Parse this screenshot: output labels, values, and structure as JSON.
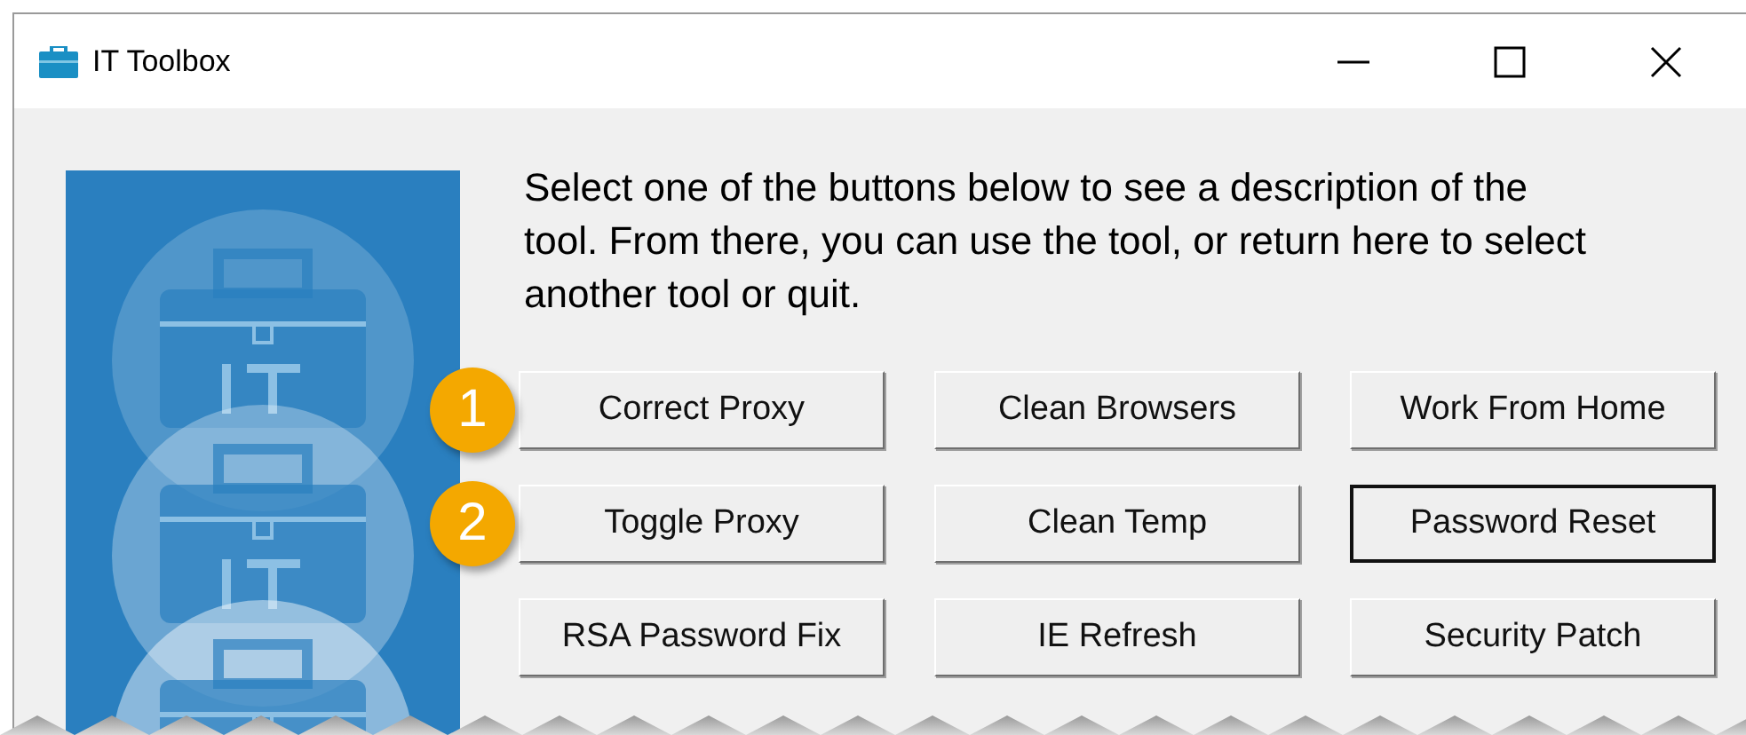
{
  "window": {
    "title": "IT Toolbox"
  },
  "intro": "Select one of the buttons below to see a description of the tool. From there, you can use the tool, or return here to select another tool or quit.",
  "buttons": [
    {
      "label": "Correct Proxy",
      "badge": "1",
      "focused": false
    },
    {
      "label": "Clean Browsers",
      "focused": false
    },
    {
      "label": "Work From Home",
      "focused": false
    },
    {
      "label": "Toggle Proxy",
      "badge": "2",
      "focused": false
    },
    {
      "label": "Clean Temp",
      "focused": false
    },
    {
      "label": "Password Reset",
      "focused": true
    },
    {
      "label": "RSA Password Fix",
      "focused": false
    },
    {
      "label": "IE Refresh",
      "focused": false
    },
    {
      "label": "Security Patch",
      "focused": false
    }
  ]
}
